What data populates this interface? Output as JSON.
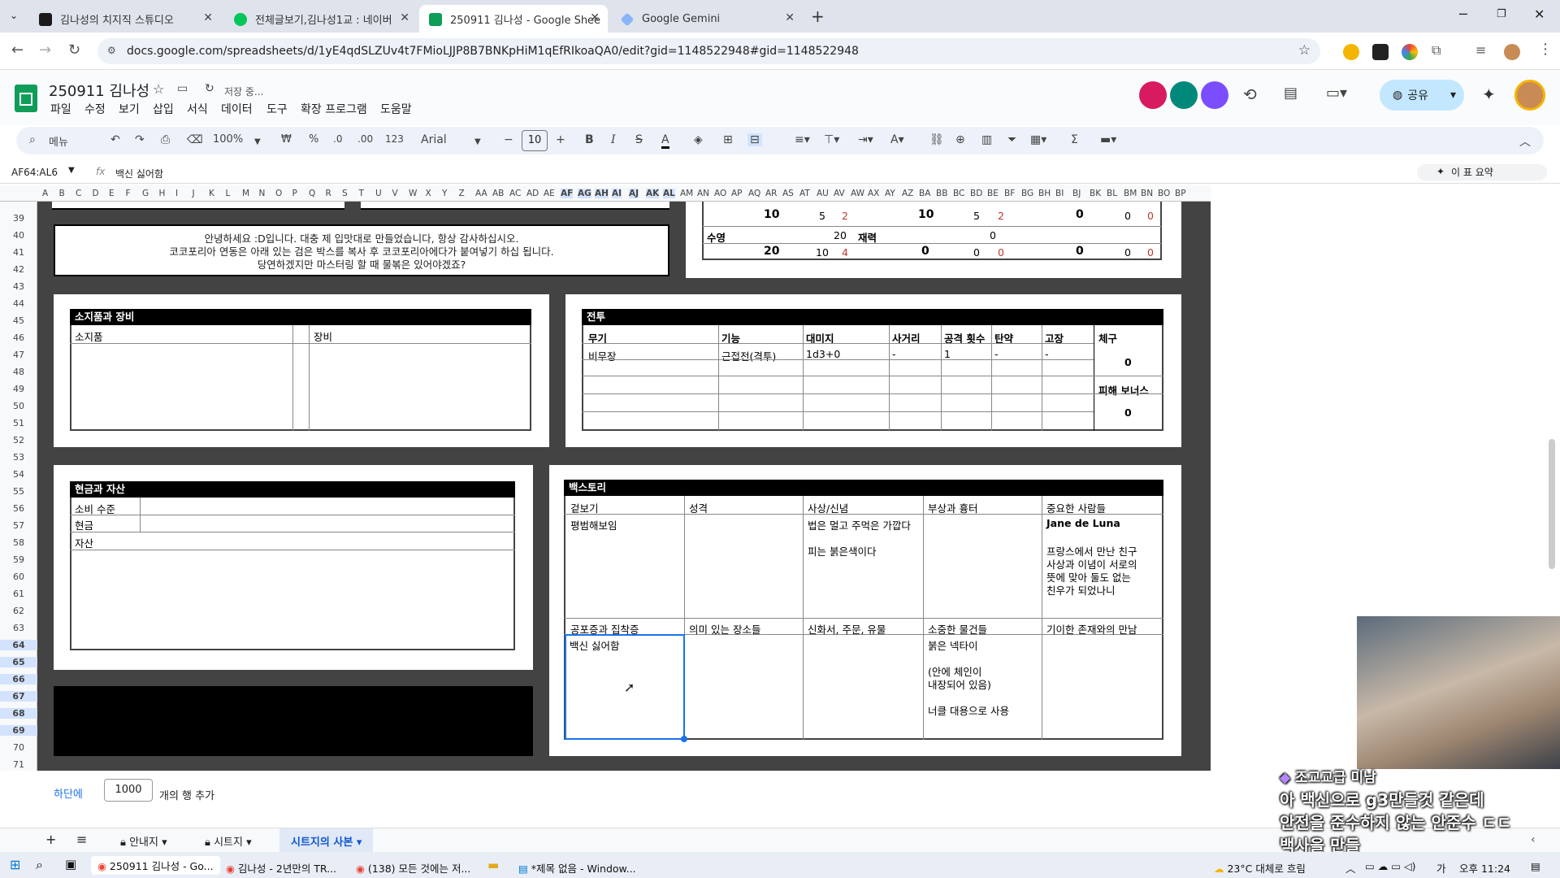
{
  "browser": {
    "tabs": [
      {
        "label": "김나성의 치지직 스튜디오",
        "color": "#1b1b1b"
      },
      {
        "label": "전체글보기,김나성1교 : 네이버",
        "color": "#03c75a"
      },
      {
        "label": "250911 김나성 - Google Shee",
        "color": "#0f9d58"
      },
      {
        "label": "Google Gemini",
        "color": "#8ab4f8"
      }
    ],
    "url": "docs.google.com/spreadsheets/d/1yE4qdSLZUv4t7FMioLJJP8B7BNKpHiM1qEfRIkoaQA0/edit?gid=1148522948#gid=1148522948"
  },
  "app": {
    "title": "250911 김나성",
    "saving": "저장 중...",
    "menus": [
      "파일",
      "수정",
      "보기",
      "삽입",
      "서식",
      "데이터",
      "도구",
      "확장 프로그램",
      "도움말"
    ],
    "share_label": "공유",
    "toolbar": {
      "search": "메뉴",
      "zoom": "100%",
      "won": "₩",
      "percent": "%",
      "dec1": ".0",
      "dec2": ".00",
      "num": "123",
      "font": "Arial",
      "size": "10"
    },
    "name_box": "AF64:AL6",
    "fx": "fx",
    "formula": "백신 싫어함",
    "summary": "이 표 요약"
  },
  "columns": [
    "A",
    "B",
    "C",
    "D",
    "E",
    "F",
    "G",
    "H",
    "I",
    "J",
    "K",
    "L",
    "M",
    "N",
    "O",
    "P",
    "Q",
    "R",
    "S",
    "T",
    "U",
    "V",
    "W",
    "X",
    "Y",
    "Z",
    "AA",
    "AB",
    "AC",
    "AD",
    "AE",
    "AF",
    "AG",
    "AH",
    "AI",
    "AJ",
    "AK",
    "AL",
    "AM",
    "AN",
    "AO",
    "AP",
    "AQ",
    "AR",
    "AS",
    "AT",
    "AU",
    "AV",
    "AW",
    "AX",
    "AY",
    "AZ",
    "BA",
    "BB",
    "BC",
    "BD",
    "BE",
    "BF",
    "BG",
    "BH",
    "BI",
    "BJ",
    "BK",
    "BL",
    "BM",
    "BN",
    "BO",
    "BP"
  ],
  "rows": [
    "39",
    "40",
    "41",
    "42",
    "43",
    "44",
    "45",
    "46",
    "47",
    "48",
    "49",
    "50",
    "51",
    "52",
    "53",
    "54",
    "55",
    "56",
    "57",
    "58",
    "59",
    "60",
    "61",
    "62",
    "63",
    "64",
    "65",
    "66",
    "67",
    "68",
    "69",
    "70",
    "71"
  ],
  "sheet": {
    "notice": [
      "안녕하세요 :D입니다. 대충 제 입맛대로 만들었습니다, 항상 감사하십시오.",
      "코코포리아 연동은 아래 있는 검은 박스를 복사 후 코코포리아에다가 붙여넣기 하십 됩니다.",
      "당연하겠지만 마스터링 할 때 물볶은 있어야겠죠?"
    ],
    "stats": {
      "row1": [
        "10",
        "5",
        "2",
        "10",
        "5",
        "2",
        "0",
        "0",
        "0"
      ],
      "swim_label": "수영",
      "swim_val": "20",
      "wealth_label": "재력",
      "wealth_val": "0",
      "row3": [
        "20",
        "10",
        "4",
        "0",
        "0",
        "0",
        "0",
        "0",
        "0"
      ]
    },
    "items": {
      "header": "소지품과 장비",
      "col1": "소지품",
      "col2": "장비"
    },
    "combat": {
      "header": "전투",
      "cols": [
        "무기",
        "기능",
        "대미지",
        "사거리",
        "공격 횟수",
        "탄약",
        "고장",
        "체구"
      ],
      "row": [
        "비무장",
        "근접전(격투)",
        "1d3+0",
        "-",
        "1",
        "-",
        "-"
      ],
      "build_val": "0",
      "bonus_label": "피해 보너스",
      "bonus_val": "0"
    },
    "cash": {
      "header": "현금과 자산",
      "spending": "소비 수준",
      "cash": "현금",
      "assets": "자산"
    },
    "backstory": {
      "header": "백스토리",
      "top_headers": [
        "겉보기",
        "성격",
        "사상/신념",
        "부상과 흉터",
        "중요한 사람들"
      ],
      "appearance": "평범해보임",
      "belief1": "법은 멀고 주먹은 가깝다",
      "belief2": "피는 붉은색이다",
      "person_name": "Jane de Luna",
      "person_desc": [
        "프랑스에서 만난 친구",
        "사상과 이념이 서로의",
        "뜻에 맞아 둘도 없는",
        "친우가 되었나니"
      ],
      "bottom_headers": [
        "공포증과 집착증",
        "의미 있는 장소들",
        "신화서, 주문, 유물",
        "소중한 물건들",
        "기이한 존재와의 만남"
      ],
      "phobia": "백신 싫어함",
      "treasure": [
        "붉은 넥타이",
        "(안에 체인이",
        "내장되어 있음)",
        "너클 대용으로 사용"
      ]
    },
    "add_rows": {
      "prefix": "하단에",
      "count": "1000",
      "suffix": "개의 행 추가"
    }
  },
  "sheet_tabs": [
    "안내지",
    "시트지",
    "시트지의 사본"
  ],
  "taskbar": {
    "apps": [
      "250911 김나성 - Go...",
      "김나성 - 2년만의 TR...",
      "(138) 모든 것에는 저...",
      "*제목 없음 - Window..."
    ],
    "weather": "23°C 대체로 흐림",
    "ime": "가",
    "time": "오후 11:24"
  },
  "stream_chat": {
    "user": "조교교급 미남",
    "lines": [
      "아 백신으로 g3만들것 같은데",
      "안전을 준수하지 않는 안준수 ㄷㄷ",
      "백사을 만들"
    ]
  }
}
